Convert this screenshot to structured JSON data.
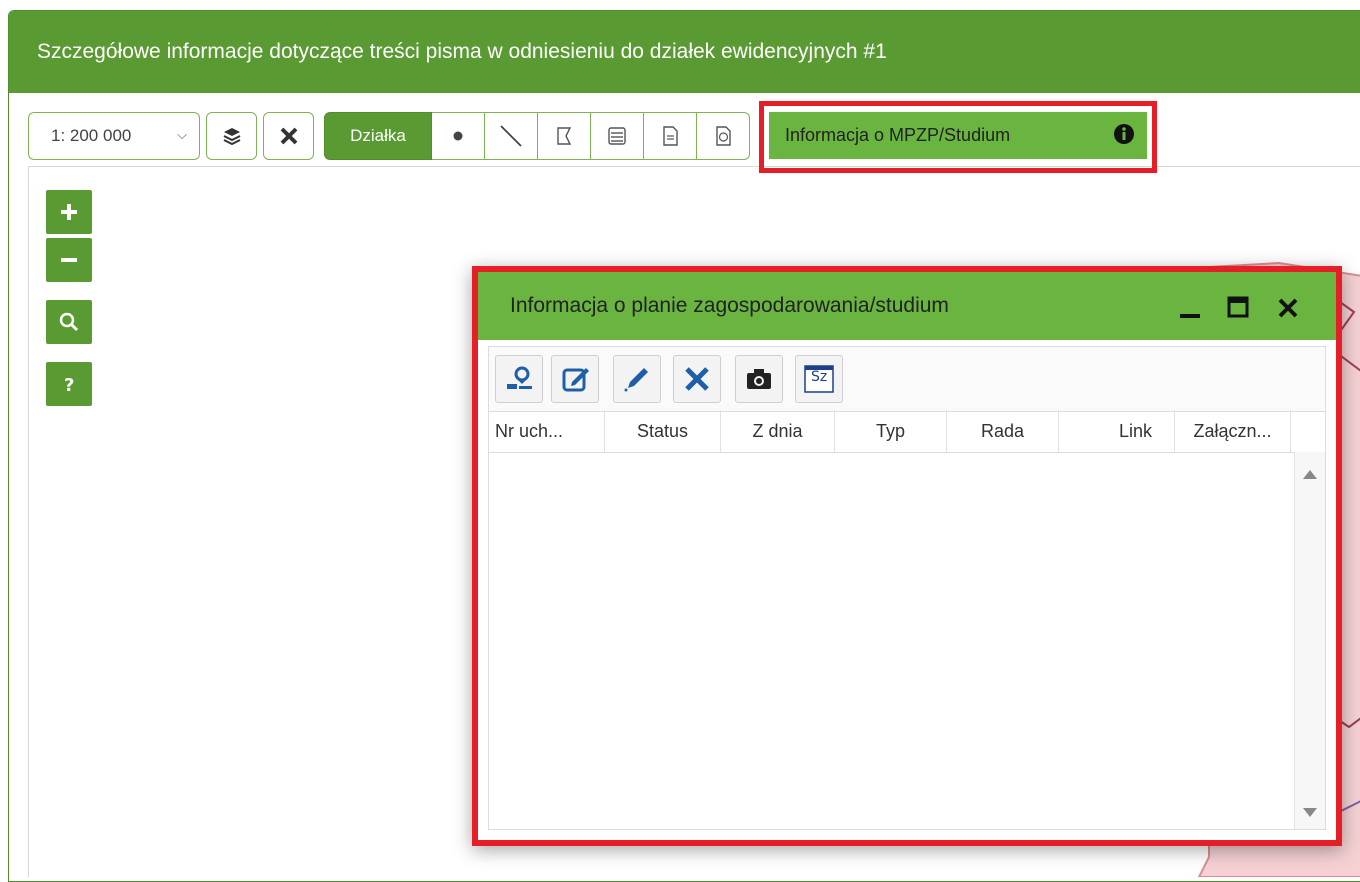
{
  "panel": {
    "title": "Szczegółowe informacje dotyczące treści pisma w odniesieniu do działek ewidencyjnych #1"
  },
  "toolbar": {
    "scale_value": "1: 200 000",
    "parcel_label": "Działka",
    "mpzp_label": "Informacja o MPZP/Studium"
  },
  "dialog": {
    "title": "Informacja o planie zagospodarowania/studium",
    "toolbar_icons": [
      "locate-parcel-icon",
      "edit-icon",
      "pencil-icon",
      "delete-icon",
      "camera-icon",
      "sz-icon"
    ],
    "sz_label": "Sz",
    "columns": [
      "Nr uch...",
      "Status",
      "Z dnia",
      "Typ",
      "Rada",
      "Link",
      "Załączn..."
    ]
  },
  "colors": {
    "header_green": "#5a9a32",
    "button_green": "#6ab440",
    "highlight_red": "#e61e28"
  }
}
